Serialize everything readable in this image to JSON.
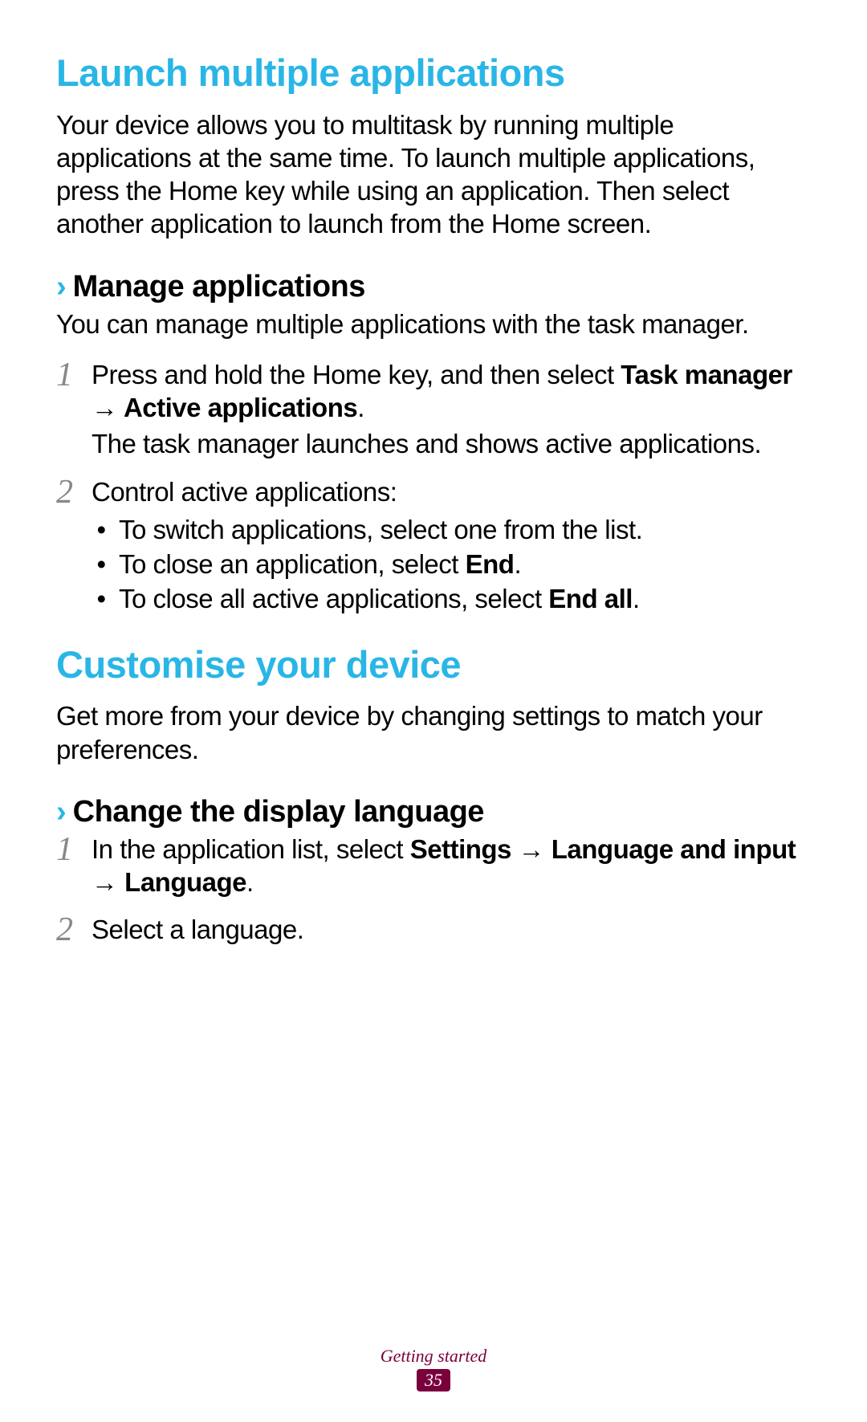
{
  "section1": {
    "heading": "Launch multiple applications",
    "intro": "Your device allows you to multitask by running multiple applications at the same time. To launch multiple applications, press the Home key while using an application. Then select another application to launch from the Home screen.",
    "sub": {
      "chevron": "›",
      "title": "Manage applications",
      "intro": "You can manage multiple applications with the task manager.",
      "step1": {
        "num": "1",
        "line_a": "Press and hold the Home key, and then select ",
        "bold_a": "Task manager",
        "arrow": " → ",
        "bold_b": "Active applications",
        "period": ".",
        "follow": "The task manager launches and shows active applications."
      },
      "step2": {
        "num": "2",
        "line": "Control active applications:",
        "bullets": {
          "dot": "•",
          "b1": "To switch applications, select one from the list.",
          "b2_a": "To close an application, select ",
          "b2_bold": "End",
          "b2_period": ".",
          "b3_a": "To close all active applications, select ",
          "b3_bold": "End all",
          "b3_period": "."
        }
      }
    }
  },
  "section2": {
    "heading": "Customise your device",
    "intro": "Get more from your device by changing settings to match your preferences.",
    "sub": {
      "chevron": "›",
      "title": "Change the display language",
      "step1": {
        "num": "1",
        "line_a": "In the application list, select ",
        "bold_a": "Settings",
        "arrow1": " → ",
        "bold_b": "Language and input",
        "arrow2": " → ",
        "bold_c": "Language",
        "period": "."
      },
      "step2": {
        "num": "2",
        "line": "Select a language."
      }
    }
  },
  "footer": {
    "label": "Getting started",
    "page": "35"
  }
}
